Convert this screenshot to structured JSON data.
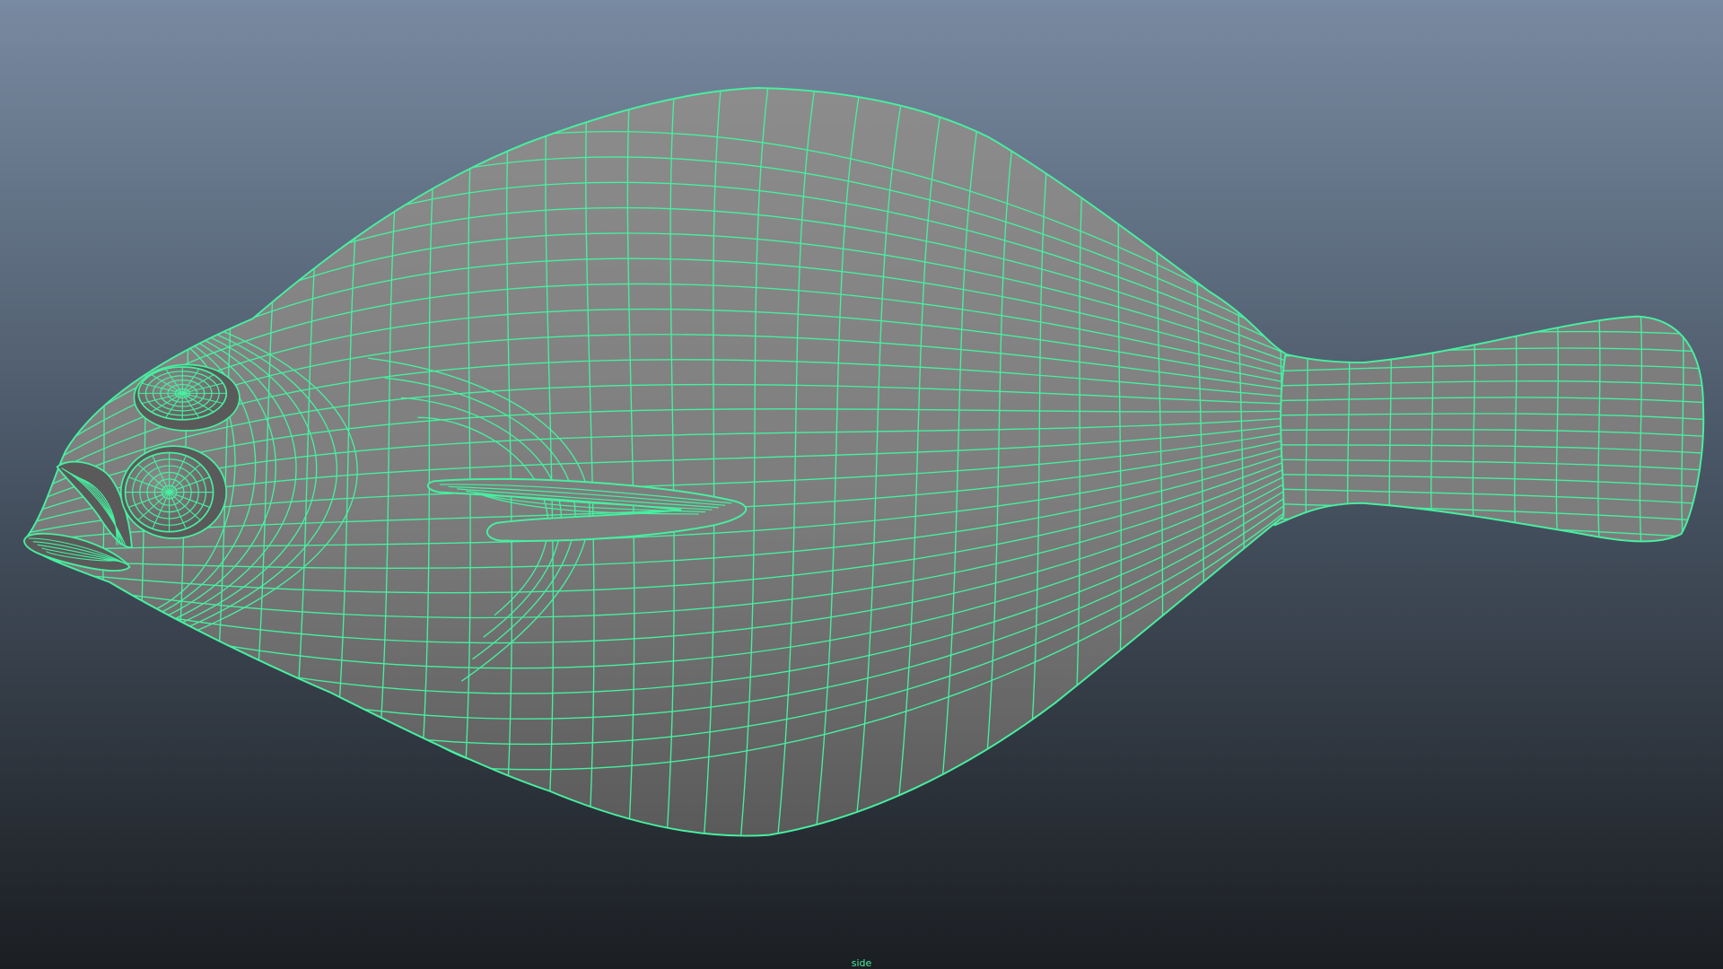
{
  "viewport": {
    "camera_label": "side",
    "background_top": "#788aa1",
    "background_mid": "#4b5868",
    "background_bottom": "#1b1e22"
  },
  "model": {
    "name": "fish",
    "surface_color": "#7d7d7d",
    "surface_dark": "#5a5a5a",
    "surface_light": "#8c8c8c",
    "wire_color": "#46f0a0"
  }
}
